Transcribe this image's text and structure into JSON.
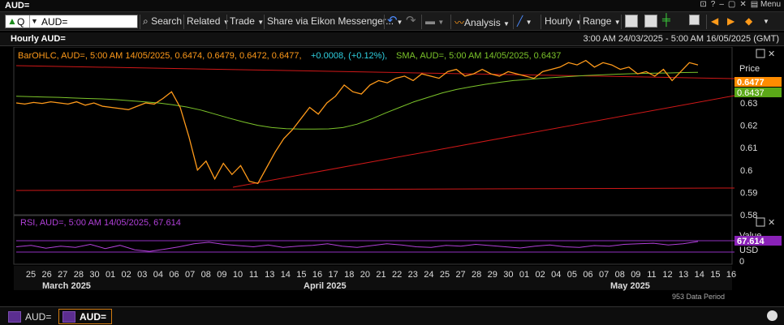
{
  "window": {
    "title": "AUD=",
    "menu_label": "Menu"
  },
  "toolbar": {
    "ric_value": "AUD=",
    "q_label": "Q",
    "search_label": "Search",
    "related_label": "Related",
    "trade_label": "Trade",
    "share_label": "Share via Eikon Messenger...",
    "analysis_label": "Analysis",
    "interval_label": "Hourly",
    "range_label": "Range"
  },
  "header": {
    "title": "Hourly AUD=",
    "date_range": "3:00 AM 24/03/2025 - 5:00 AM 16/05/2025 (GMT)"
  },
  "price_panel": {
    "legend_ohlc": "BarOHLC, AUD=, 5:00 AM 14/05/2025, 0.6474, 0.6479, 0.6472, 0.6477,",
    "legend_change": "+0.0008, (+0.12%),",
    "legend_sma": "SMA, AUD=, 5:00 AM 14/05/2025, 0.6437",
    "axis_title": "Price",
    "last_price_label": "0.6477",
    "sma_price_label": "0.6437",
    "last_price_color": "#ff8c00",
    "sma_color": "#7cc42a"
  },
  "rsi_panel": {
    "legend": "RSI, AUD=, 5:00 AM 14/05/2025, 67.614",
    "axis_title": "Value",
    "axis_unit": "USD",
    "value_label": "67.614",
    "color": "#b040d8"
  },
  "x_axis": {
    "month_labels": [
      "March 2025",
      "April 2025",
      "May 2025"
    ],
    "footer_note": "953 Data Period"
  },
  "chart_data": {
    "type": "line",
    "title": "Hourly AUD=",
    "x_tick_labels": [
      "25",
      "26",
      "27",
      "28",
      "30",
      "01",
      "02",
      "03",
      "04",
      "06",
      "07",
      "08",
      "09",
      "10",
      "11",
      "13",
      "14",
      "15",
      "16",
      "17",
      "18",
      "20",
      "21",
      "22",
      "23",
      "24",
      "25",
      "27",
      "28",
      "29",
      "30",
      "01",
      "02",
      "04",
      "05",
      "06",
      "07",
      "08",
      "09",
      "11",
      "12",
      "13",
      "14",
      "15",
      "16"
    ],
    "y_ticks": [
      0.58,
      0.59,
      0.6,
      0.61,
      0.62,
      0.63,
      0.64
    ],
    "ylim": [
      0.58,
      0.655
    ],
    "rsi_ticks": [
      0
    ],
    "series": [
      {
        "name": "AUD= price (BarOHLC)",
        "color": "#ff9a1a",
        "values": [
          0.63,
          0.6295,
          0.6302,
          0.6298,
          0.6305,
          0.63,
          0.6295,
          0.6305,
          0.629,
          0.63,
          0.6285,
          0.628,
          0.6275,
          0.627,
          0.6285,
          0.63,
          0.6295,
          0.632,
          0.635,
          0.628,
          0.615,
          0.6,
          0.604,
          0.596,
          0.603,
          0.598,
          0.602,
          0.595,
          0.594,
          0.601,
          0.608,
          0.614,
          0.618,
          0.623,
          0.628,
          0.625,
          0.63,
          0.633,
          0.638,
          0.635,
          0.634,
          0.638,
          0.64,
          0.639,
          0.641,
          0.642,
          0.64,
          0.643,
          0.642,
          0.641,
          0.644,
          0.645,
          0.642,
          0.643,
          0.645,
          0.643,
          0.642,
          0.644,
          0.643,
          0.642,
          0.641,
          0.644,
          0.645,
          0.646,
          0.648,
          0.647,
          0.649,
          0.646,
          0.648,
          0.647,
          0.645,
          0.646,
          0.643,
          0.644,
          0.642,
          0.645,
          0.64,
          0.644,
          0.648,
          0.647
        ]
      },
      {
        "name": "SMA",
        "color": "#7cc42a",
        "values": [
          0.633,
          0.6328,
          0.6326,
          0.6325,
          0.6322,
          0.632,
          0.6318,
          0.6315,
          0.631,
          0.6305,
          0.63,
          0.6292,
          0.6282,
          0.6268,
          0.625,
          0.6232,
          0.6215,
          0.62,
          0.619,
          0.6185,
          0.6183,
          0.6183,
          0.6184,
          0.619,
          0.6205,
          0.6228,
          0.6255,
          0.628,
          0.6305,
          0.6325,
          0.6345,
          0.636,
          0.6372,
          0.6383,
          0.6392,
          0.64,
          0.6405,
          0.641,
          0.6414,
          0.6418,
          0.6422,
          0.6425,
          0.6428,
          0.643,
          0.6432,
          0.6433,
          0.6434,
          0.6436,
          0.6437
        ]
      },
      {
        "name": "RSI",
        "color": "#b040d8",
        "values": [
          50,
          55,
          45,
          52,
          48,
          58,
          44,
          55,
          40,
          35,
          42,
          50,
          60,
          65,
          58,
          54,
          50,
          56,
          48,
          52,
          55,
          60,
          52,
          48,
          54,
          60,
          56,
          50,
          48,
          55,
          52,
          58,
          54,
          50,
          46,
          52,
          56,
          50,
          48,
          54,
          52,
          58,
          60,
          62,
          56,
          60,
          67.614
        ]
      }
    ]
  }
}
